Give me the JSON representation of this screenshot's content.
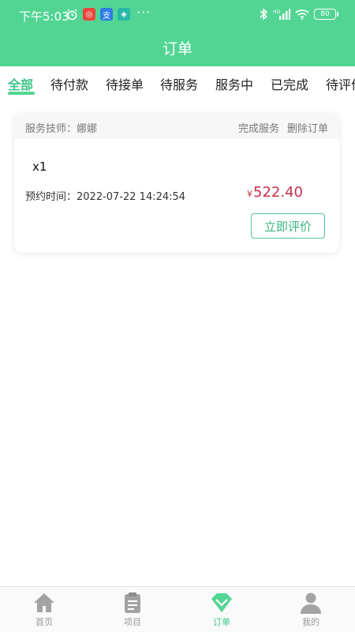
{
  "status_bar": {
    "time": "下午5:03",
    "signal": "HD",
    "battery": "80"
  },
  "header": {
    "title": "订单"
  },
  "tabs": [
    {
      "label": "全部",
      "active": true
    },
    {
      "label": "待付款"
    },
    {
      "label": "待接单"
    },
    {
      "label": "待服务"
    },
    {
      "label": "服务中"
    },
    {
      "label": "已完成"
    },
    {
      "label": "待评价"
    }
  ],
  "order": {
    "technician_label": "服务技师：娜娜",
    "complete_label": "完成服务",
    "delete_label": "删除订单",
    "quantity": "x1",
    "appointment": "预约时间：2022-07-22 14:24:54",
    "currency": "¥",
    "price": "522.40",
    "rate_button": "立即评价"
  },
  "bottom_nav": [
    {
      "label": "首页",
      "icon": "home-icon"
    },
    {
      "label": "项目",
      "icon": "clipboard-icon"
    },
    {
      "label": "订单",
      "icon": "diamond-icon",
      "active": true
    },
    {
      "label": "我的",
      "icon": "person-icon"
    }
  ],
  "colors": {
    "brand": "#52d593",
    "price": "#c8304a",
    "accent_text": "#3cc487"
  }
}
